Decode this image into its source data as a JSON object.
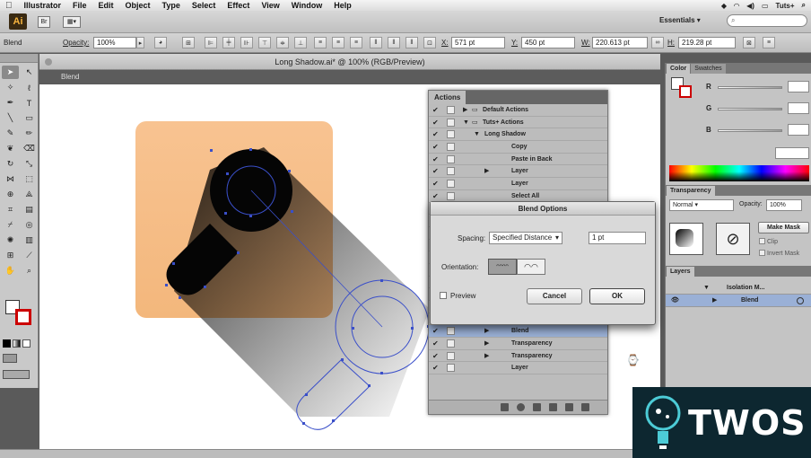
{
  "menubar": {
    "apple": "",
    "items": [
      "Illustrator",
      "File",
      "Edit",
      "Object",
      "Type",
      "Select",
      "Effect",
      "View",
      "Window",
      "Help"
    ],
    "right": "Tuts+"
  },
  "appbar": {
    "logo": "Ai",
    "workspace": "Essentials ▾",
    "search_placeholder": ""
  },
  "controlbar": {
    "selection": "Blend",
    "opacity_label": "Opacity:",
    "opacity_value": "100%",
    "x_label": "X:",
    "x_value": "571 pt",
    "y_label": "Y:",
    "y_value": "450 pt",
    "w_label": "W:",
    "w_value": "220.613 pt",
    "h_label": "H:",
    "h_value": "219.28 pt"
  },
  "document": {
    "title": "Long Shadow.ai* @ 100% (RGB/Preview)",
    "breadcrumb": "Blend"
  },
  "actions_panel": {
    "tab": "Actions",
    "rows": [
      {
        "label": "Default Actions",
        "indent": 0,
        "tri": "▶",
        "folder": true,
        "sel": false
      },
      {
        "label": "Tuts+ Actions",
        "indent": 0,
        "tri": "▼",
        "folder": true,
        "sel": false
      },
      {
        "label": "Long Shadow",
        "indent": 1,
        "tri": "▼",
        "folder": false,
        "sel": false
      },
      {
        "label": "Copy",
        "indent": 2,
        "tri": "",
        "folder": false,
        "sel": false
      },
      {
        "label": "Paste in Back",
        "indent": 2,
        "tri": "",
        "folder": false,
        "sel": false
      },
      {
        "label": "Layer",
        "indent": 2,
        "tri": "▶",
        "folder": false,
        "sel": false
      },
      {
        "label": "Layer",
        "indent": 2,
        "tri": "",
        "folder": false,
        "sel": false
      },
      {
        "label": "Select All",
        "indent": 2,
        "tri": "",
        "folder": false,
        "sel": false
      },
      {
        "label": "",
        "indent": 2,
        "tri": "",
        "folder": false,
        "sel": false
      },
      {
        "label": "",
        "indent": 2,
        "tri": "",
        "folder": false,
        "sel": false
      },
      {
        "label": "",
        "indent": 2,
        "tri": "",
        "folder": false,
        "sel": false
      },
      {
        "label": "",
        "indent": 2,
        "tri": "",
        "folder": false,
        "sel": false
      },
      {
        "label": "",
        "indent": 2,
        "tri": "",
        "folder": false,
        "sel": false
      },
      {
        "label": "",
        "indent": 2,
        "tri": "",
        "folder": false,
        "sel": false
      },
      {
        "label": "",
        "indent": 2,
        "tri": "",
        "folder": false,
        "sel": false
      },
      {
        "label": "",
        "indent": 2,
        "tri": "",
        "folder": false,
        "sel": false
      },
      {
        "label": "",
        "indent": 2,
        "tri": "",
        "folder": false,
        "sel": false
      },
      {
        "label": "",
        "indent": 2,
        "tri": "",
        "folder": false,
        "sel": false
      },
      {
        "label": "Blend",
        "indent": 2,
        "tri": "▶",
        "folder": false,
        "sel": true
      },
      {
        "label": "Transparency",
        "indent": 2,
        "tri": "▶",
        "folder": false,
        "sel": false
      },
      {
        "label": "Transparency",
        "indent": 2,
        "tri": "▶",
        "folder": false,
        "sel": false
      },
      {
        "label": "Layer",
        "indent": 2,
        "tri": "",
        "folder": false,
        "sel": false
      }
    ]
  },
  "blend_dialog": {
    "title": "Blend Options",
    "spacing_label": "Spacing:",
    "spacing_value": "Specified Distance",
    "distance_value": "1 pt",
    "orientation_label": "Orientation:",
    "preview_label": "Preview",
    "cancel_label": "Cancel",
    "ok_label": "OK"
  },
  "right_panels": {
    "color_tabs": [
      "Color",
      "Swatches"
    ],
    "channels": [
      "R",
      "G",
      "B"
    ],
    "transparency_tab": "Transparency",
    "blend_mode": "Normal",
    "opacity_label": "Opacity:",
    "opacity_value": "100%",
    "make_mask": "Make Mask",
    "clip_label": "Clip",
    "invert_label": "Invert Mask",
    "layers_tab": "Layers",
    "layers": [
      {
        "label": "Isolation M...",
        "indent": 1
      },
      {
        "label": "Blend",
        "indent": 2
      }
    ]
  },
  "watermark": {
    "text": "TWOS"
  },
  "colors": {
    "orange_square": "#f7c08a",
    "selection_blue": "#3a4fc9",
    "accent_red": "#cc0000"
  }
}
